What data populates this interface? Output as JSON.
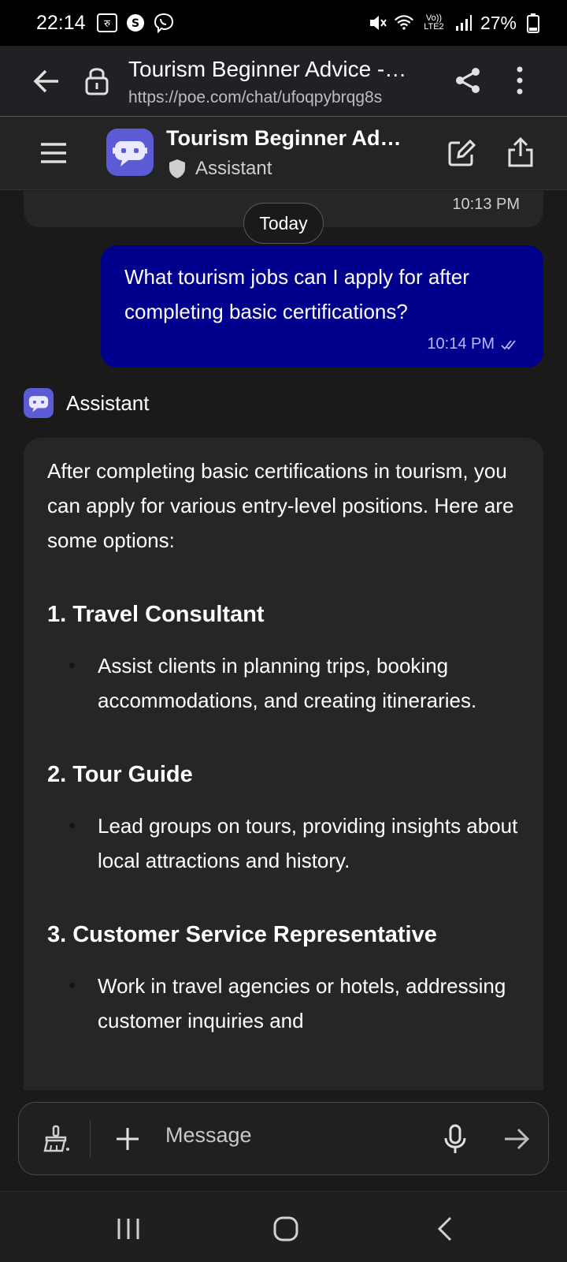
{
  "status_bar": {
    "time": "22:14",
    "battery": "27%",
    "network": "Vo)) LTE2",
    "left_icons": [
      "rupee-icon",
      "s-icon",
      "viber-icon"
    ],
    "right_icons": [
      "mute-icon",
      "wifi-icon",
      "signal-icon",
      "battery-icon"
    ]
  },
  "browser": {
    "title": "Tourism Beginner Advice -…",
    "url": "https://poe.com/chat/ufoqpybrqg8s"
  },
  "header": {
    "bot_name": "Tourism Beginner Ad…",
    "subtitle": "Assistant"
  },
  "chat": {
    "previous_message_time": "10:13 PM",
    "date_separator": "Today",
    "user_message": {
      "text": "What tourism jobs can I apply for after completing basic certifications?",
      "time": "10:14 PM"
    },
    "assistant_label": "Assistant",
    "assistant_message": {
      "intro": "After completing basic certifications in tourism, you can apply for various entry-level positions. Here are some options:",
      "jobs": [
        {
          "title": "1. Travel Consultant",
          "description": "Assist clients in planning trips, booking accommodations, and creating itineraries."
        },
        {
          "title": "2. Tour Guide",
          "description": "Lead groups on tours, providing insights about local attractions and history."
        },
        {
          "title": "3. Customer Service Representative",
          "description": "Work in travel agencies or hotels, addressing customer inquiries and"
        }
      ]
    }
  },
  "composer": {
    "placeholder": "Message"
  },
  "colors": {
    "user_bubble": "#00008c",
    "bot_avatar": "#5b5bd6",
    "background": "#1a1a1a",
    "bubble": "#262626"
  }
}
